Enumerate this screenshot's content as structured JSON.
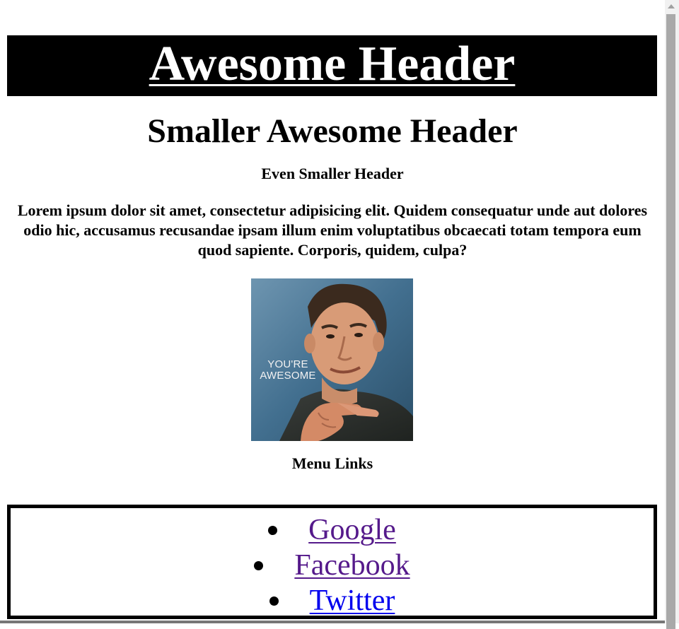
{
  "header": {
    "title": "Awesome Header"
  },
  "subheader": "Smaller Awesome Header",
  "small_header": "Even Smaller Header",
  "paragraph": "Lorem ipsum dolor sit amet, consectetur adipisicing elit. Quidem consequatur unde aut dolores odio hic, accusamus recusandae ipsam illum enim voluptatibus obcaecati totam tempora eum quod sapiente. Corporis, quidem, culpa?",
  "image": {
    "caption_line1": "YOU'RE",
    "caption_line2": "AWESOME"
  },
  "menu": {
    "heading": "Menu Links",
    "links": [
      {
        "label": "Google",
        "state": "visited",
        "color": "#551a8b"
      },
      {
        "label": "Facebook",
        "state": "visited",
        "color": "#551a8b"
      },
      {
        "label": "Twitter",
        "state": "unvisited",
        "color": "#0000ee"
      }
    ]
  },
  "colors": {
    "header_background": "#000000",
    "header_text": "#ffffff",
    "visited_link": "#551a8b",
    "unvisited_link": "#0000ee"
  }
}
